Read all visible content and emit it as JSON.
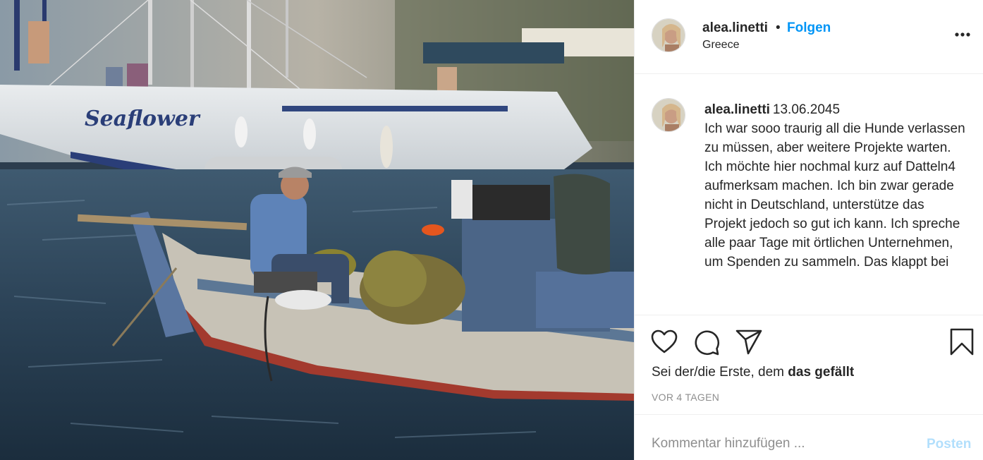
{
  "post": {
    "photo_icon": "harbor-photo",
    "boat_name": "Seaflower"
  },
  "header": {
    "username": "alea.linetti",
    "separator": "•",
    "follow_label": "Folgen",
    "location": "Greece",
    "more_icon": "more-options-icon"
  },
  "caption": {
    "username": "alea.linetti",
    "date": "13.06.2045",
    "text": "Ich war sooo traurig all die Hunde verlassen zu müssen, aber weitere Projekte warten. Ich möchte hier nochmal kurz auf Datteln4 aufmerksam machen. Ich bin zwar gerade nicht in Deutschland, unterstütze das Projekt jedoch so gut ich kann. Ich spreche alle paar Tage mit örtlichen Unternehmen, um Spenden zu sammeln. Das klappt bei"
  },
  "actions": {
    "icons": [
      "heart-icon",
      "comment-bubble-icon",
      "paper-plane-icon",
      "bookmark-icon"
    ],
    "likes_prefix": "Sei der/die Erste, dem ",
    "likes_bold": "das gefällt",
    "age": "VOR 4 TAGEN"
  },
  "comment_box": {
    "placeholder": "Kommentar hinzufügen ...",
    "post_label": "Posten"
  },
  "colors": {
    "accent": "#0095f6",
    "accent_disabled": "#b2dffc",
    "muted": "#8e8e8e",
    "text": "#262626",
    "border": "#efefef"
  }
}
